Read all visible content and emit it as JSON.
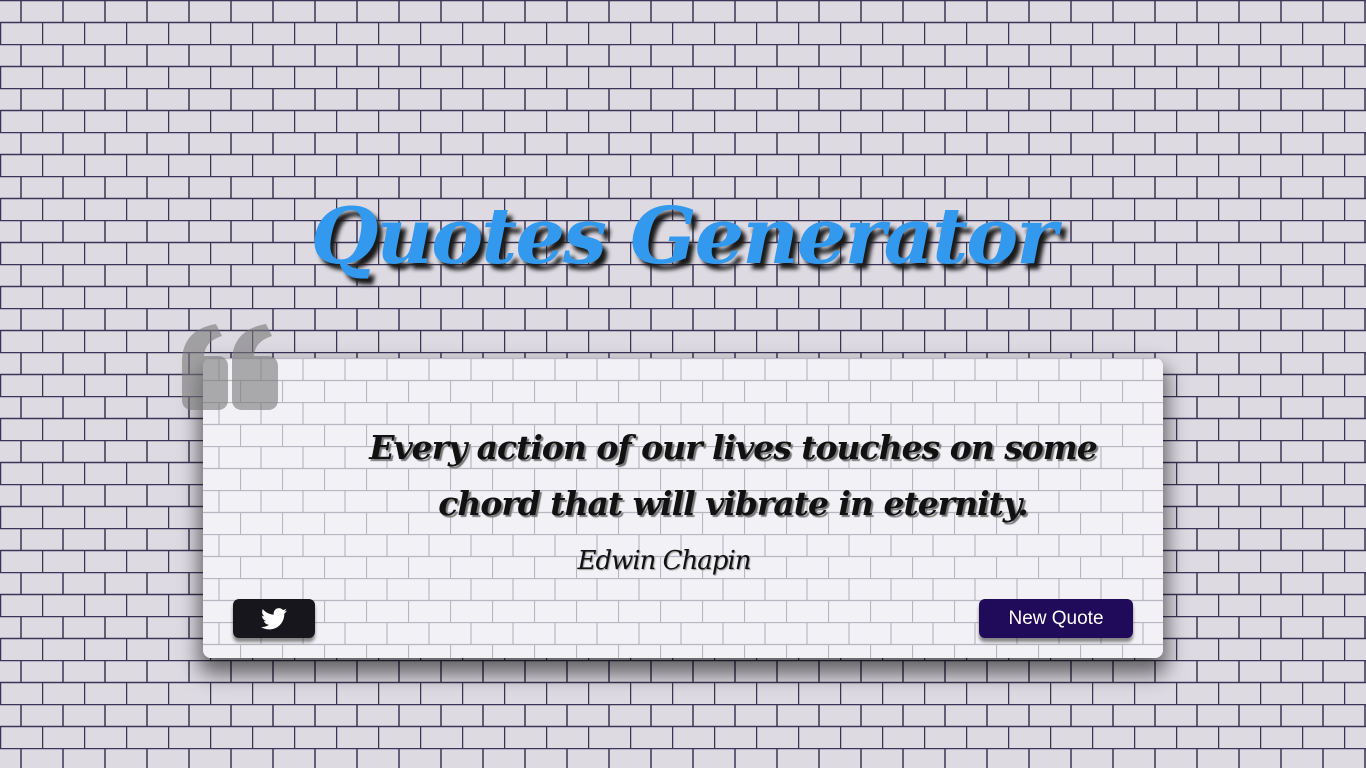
{
  "header": {
    "title": "Quotes Generator"
  },
  "quote": {
    "text": "Every action of our lives touches on some chord that will vibrate in eternity.",
    "author": "Edwin Chapin"
  },
  "actions": {
    "tweet_icon": "twitter-icon",
    "new_quote_label": "New Quote"
  },
  "colors": {
    "title": "#3399ee",
    "wall_mortar": "#3a3556",
    "wall_brick": "#dddae2",
    "card_background": "#f2f1f5",
    "twitter_button": "#16161c",
    "new_quote_button": "#1f0b5a"
  }
}
